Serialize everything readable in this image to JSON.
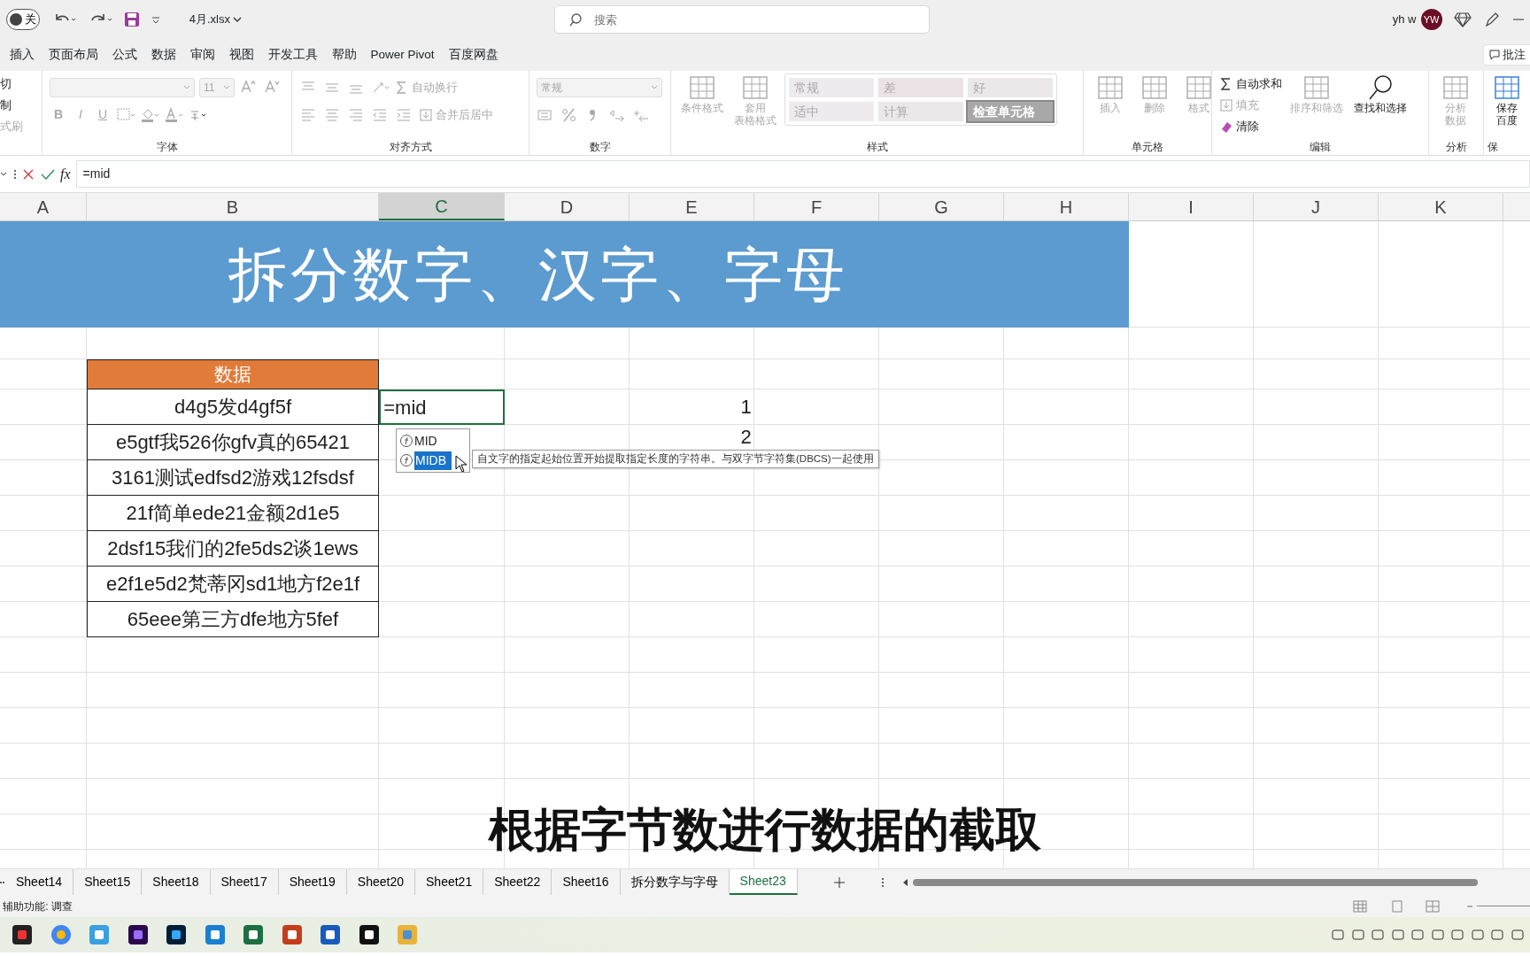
{
  "title_bar": {
    "autosave_label": "关",
    "autosave_on": false,
    "file_name": "4月.xlsx",
    "search_placeholder": "搜索",
    "user_name": "yh w",
    "avatar_initials": "YW"
  },
  "menu_tabs": [
    {
      "label": "插入"
    },
    {
      "label": "页面布局"
    },
    {
      "label": "公式"
    },
    {
      "label": "数据"
    },
    {
      "label": "审阅"
    },
    {
      "label": "视图"
    },
    {
      "label": "开发工具"
    },
    {
      "label": "帮助"
    },
    {
      "label": "Power Pivot"
    },
    {
      "label": "百度网盘"
    }
  ],
  "comment_button": "批注",
  "ribbon": [
    {
      "parts": [
        {
          "kind": "rows",
          "rows": [
            [
              {
                "kind": "small",
                "label": "切",
                "disabled": false
              }
            ],
            [
              {
                "kind": "small",
                "label": "制",
                "disabled": false
              }
            ],
            [
              {
                "kind": "small",
                "label": "式刷",
                "disabled": true
              }
            ]
          ]
        }
      ]
    },
    {
      "label": "字体",
      "parts": [
        {
          "kind": "rows",
          "rows": [
            [
              {
                "kind": "dropdown",
                "disabled": true
              },
              {
                "kind": "dropdown",
                "label": "11",
                "disabled": true
              },
              {
                "kind": "icon",
                "disabled": true
              },
              {
                "kind": "icon",
                "disabled": true
              }
            ],
            [
              {
                "kind": "letter",
                "label": "B",
                "disabled": true
              },
              {
                "kind": "letter",
                "label": "I",
                "disabled": true
              },
              {
                "kind": "letter",
                "label": "U",
                "disabled": true
              },
              {
                "kind": "icon",
                "disabled": true
              },
              {
                "kind": "icon",
                "disabled": true
              },
              {
                "kind": "icon",
                "disabled": true
              },
              {
                "kind": "icon",
                "disabled": false
              }
            ]
          ]
        }
      ]
    },
    {
      "label": "对齐方式",
      "parts": [
        {
          "kind": "rows",
          "rows": [
            [
              {
                "kind": "icon",
                "disabled": true
              },
              {
                "kind": "icon",
                "disabled": true
              },
              {
                "kind": "icon",
                "disabled": true
              },
              {
                "kind": "icon",
                "disabled": true
              },
              {
                "kind": "small",
                "label": "自动换行",
                "disabled": true
              }
            ],
            [
              {
                "kind": "icon",
                "disabled": true
              },
              {
                "kind": "icon",
                "disabled": true
              },
              {
                "kind": "icon",
                "disabled": true
              },
              {
                "kind": "icon",
                "disabled": true
              },
              {
                "kind": "icon",
                "disabled": true
              },
              {
                "kind": "small",
                "label": "合并后居中",
                "disabled": true
              }
            ]
          ]
        }
      ]
    },
    {
      "label": "数字",
      "parts": [
        {
          "kind": "rows",
          "rows": [
            [
              {
                "kind": "dropdown",
                "label": "常规",
                "disabled": true
              }
            ],
            [
              {
                "kind": "icon",
                "disabled": true
              },
              {
                "kind": "icon",
                "disabled": true
              },
              {
                "kind": "icon",
                "disabled": true
              },
              {
                "kind": "icon",
                "disabled": true
              },
              {
                "kind": "icon",
                "disabled": true
              }
            ]
          ]
        }
      ]
    },
    {
      "label": "样式",
      "parts": [
        {
          "kind": "large",
          "lines": [
            "条件格式"
          ],
          "disabled": true
        },
        {
          "kind": "large",
          "lines": [
            "套用",
            "表格格式"
          ],
          "disabled": true
        },
        {
          "kind": "gallery",
          "cells": [
            {
              "label": "常规"
            },
            {
              "label": "差"
            },
            {
              "label": "好"
            },
            {
              "label": "适中"
            },
            {
              "label": "计算"
            },
            {
              "label": "检查单元格"
            }
          ]
        }
      ]
    },
    {
      "label": "单元格",
      "parts": [
        {
          "kind": "large",
          "lines": [
            "插入"
          ],
          "disabled": true
        },
        {
          "kind": "large",
          "lines": [
            "删除"
          ],
          "disabled": true
        },
        {
          "kind": "large",
          "lines": [
            "格式"
          ],
          "disabled": true
        }
      ]
    },
    {
      "label": "编辑",
      "parts": [
        {
          "kind": "rows",
          "rows": [
            [
              {
                "kind": "small",
                "label": "自动求和",
                "disabled": false
              }
            ],
            [
              {
                "kind": "small",
                "label": "填充",
                "disabled": true
              }
            ],
            [
              {
                "kind": "small",
                "label": "清除",
                "disabled": false
              }
            ]
          ]
        },
        {
          "kind": "large",
          "lines": [
            "排序和筛选"
          ],
          "disabled": true
        },
        {
          "kind": "large",
          "lines": [
            "查找和选择"
          ],
          "disabled": false
        }
      ]
    },
    {
      "label": "分析",
      "parts": [
        {
          "kind": "large",
          "lines": [
            "分析",
            "数据"
          ],
          "disabled": true
        }
      ]
    },
    {
      "label": "保",
      "parts": [
        {
          "kind": "large",
          "lines": [
            "保存",
            "百度"
          ],
          "disabled": false
        }
      ]
    }
  ],
  "formula_bar": {
    "function_label": "fx",
    "formula": "=mid"
  },
  "columns": [
    {
      "label": "A",
      "selected": false
    },
    {
      "label": "B",
      "selected": false
    },
    {
      "label": "C",
      "selected": true
    },
    {
      "label": "D",
      "selected": false
    },
    {
      "label": "E",
      "selected": false
    },
    {
      "label": "F",
      "selected": false
    },
    {
      "label": "G",
      "selected": false
    },
    {
      "label": "H",
      "selected": false
    },
    {
      "label": "I",
      "selected": false
    },
    {
      "label": "J",
      "selected": false
    },
    {
      "label": "K",
      "selected": false
    }
  ],
  "sheet": {
    "banner": "拆分数字、汉字、字母",
    "table_header": "数据",
    "rows": [
      "d4g5发d4gf5f",
      "e5gtf我526你gfv真的65421",
      "3161测试edfsd2游戏12fsdsf",
      "21f简单ede21金额2d1e5",
      "2dsf15我们的2fe5ds2谈1ews",
      "e2f1e5d2梵蒂冈sd1地方f2e1f",
      "65eee第三方dfe地方5fef"
    ],
    "active_cell": "=mid",
    "numbers": [
      "1",
      "2"
    ]
  },
  "autocomplete": {
    "items": [
      {
        "label": "MID",
        "selected": false
      },
      {
        "label": "MIDB",
        "selected": true
      }
    ],
    "tooltip": "自文字的指定起始位置开始提取指定长度的字符串。与双字节字符集(DBCS)一起使用"
  },
  "caption": "根据字节数进行数据的截取",
  "sheet_tabs": [
    {
      "label": "Sheet14",
      "selected": false
    },
    {
      "label": "Sheet15",
      "selected": false
    },
    {
      "label": "Sheet18",
      "selected": false
    },
    {
      "label": "Sheet17",
      "selected": false
    },
    {
      "label": "Sheet19",
      "selected": false
    },
    {
      "label": "Sheet20",
      "selected": false
    },
    {
      "label": "Sheet21",
      "selected": false
    },
    {
      "label": "Sheet22",
      "selected": false
    },
    {
      "label": "Sheet16",
      "selected": false
    },
    {
      "label": "拆分数字与字母",
      "selected": false
    },
    {
      "label": "Sheet23",
      "selected": true
    }
  ],
  "status_bar": {
    "text": "辅助功能: 调查"
  }
}
